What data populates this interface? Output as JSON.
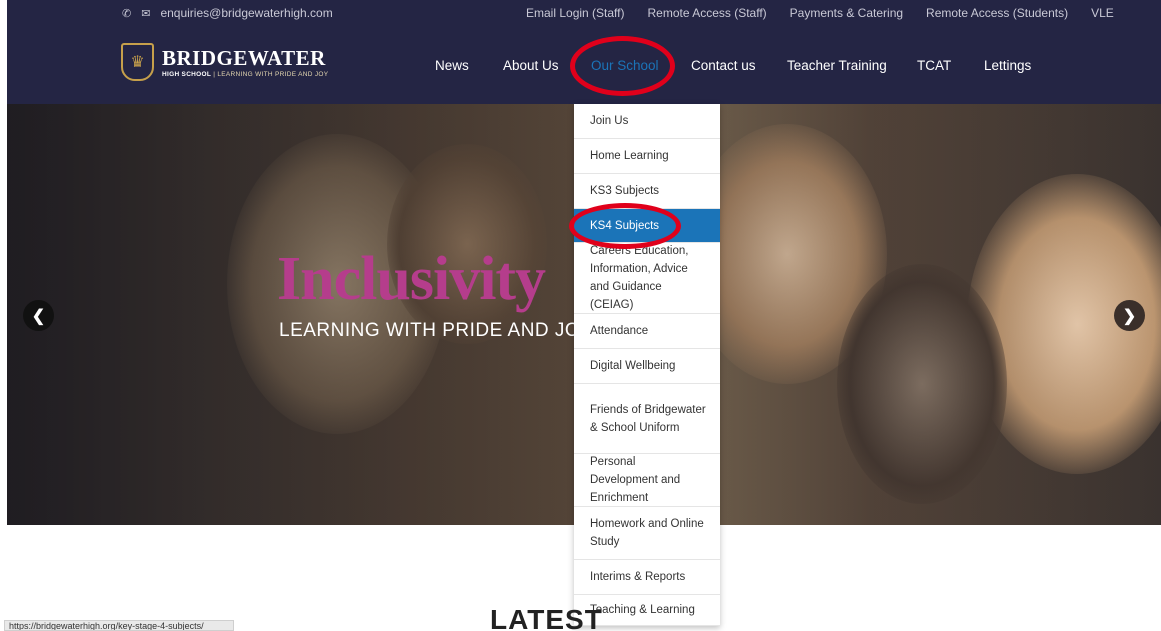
{
  "topbar": {
    "email": "enquiries@bridgewaterhigh.com",
    "phone_icon": "phone-icon",
    "mail_icon": "envelope-icon",
    "links": [
      "Email Login (Staff)",
      "Remote Access (Staff)",
      "Payments & Catering",
      "Remote Access (Students)",
      "VLE"
    ]
  },
  "logo": {
    "name": "BRIDGEWATER",
    "tag_school": "HIGH SCHOOL",
    "tag_motto": " | LEARNING WITH PRIDE AND JOY"
  },
  "nav": {
    "items": [
      "News",
      "About Us",
      "Our School",
      "Contact us",
      "Teacher Training",
      "TCAT",
      "Lettings"
    ],
    "active": "Our School"
  },
  "hero": {
    "title": "Inclusivity",
    "subtitle": "LEARNING WITH PRIDE AND JOY",
    "prev_icon": "chevron-left-icon",
    "next_icon": "chevron-right-icon"
  },
  "dropdown": {
    "items": [
      "Join Us",
      "Home Learning",
      "KS3 Subjects",
      "KS4 Subjects",
      "Careers Education, Information, Advice and Guidance (CEIAG)",
      "Attendance",
      "Digital Wellbeing",
      "Friends of Bridgewater & School Uniform",
      "Personal Development and Enrichment",
      "Homework and Online Study",
      "Interims & Reports",
      "Teaching & Learning"
    ],
    "active": "KS4 Subjects"
  },
  "section": {
    "heading": "LATEST"
  },
  "status": {
    "url": "https://bridgewaterhigh.org/key-stage-4-subjects/"
  },
  "colors": {
    "navy": "#242544",
    "accent": "#1b74b8",
    "highlight": "#e0001b",
    "hero_title": "#b53d8c",
    "gold": "#c6a04b"
  }
}
